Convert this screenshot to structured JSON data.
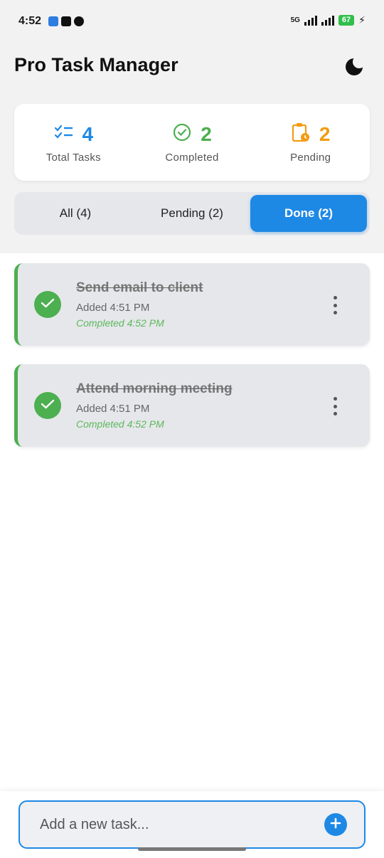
{
  "status_bar": {
    "time": "4:52",
    "apps": [
      "discord-icon",
      "youtube-icon",
      "whatsapp-icon"
    ],
    "network": "5G",
    "battery": "67"
  },
  "header": {
    "title": "Pro Task Manager",
    "theme_icon": "moon-icon"
  },
  "stats": {
    "total": {
      "value": "4",
      "label": "Total Tasks",
      "color": "#1e88e5",
      "icon": "checklist-icon"
    },
    "completed": {
      "value": "2",
      "label": "Completed",
      "color": "#4caf50",
      "icon": "check-circle-icon"
    },
    "pending": {
      "value": "2",
      "label": "Pending",
      "color": "#f39c12",
      "icon": "clipboard-clock-icon"
    }
  },
  "filters": {
    "tabs": [
      {
        "label": "All (4)",
        "active": false
      },
      {
        "label": "Pending (2)",
        "active": false
      },
      {
        "label": "Done (2)",
        "active": true
      }
    ]
  },
  "tasks": [
    {
      "title": "Send email to client",
      "added": "Added 4:51 PM",
      "completed": "Completed 4:52 PM"
    },
    {
      "title": "Attend morning meeting",
      "added": "Added 4:51 PM",
      "completed": "Completed 4:52 PM"
    }
  ],
  "add_task": {
    "placeholder": "Add a new task..."
  },
  "colors": {
    "accent": "#1e88e5",
    "success": "#4caf50",
    "warning": "#f39c12"
  }
}
